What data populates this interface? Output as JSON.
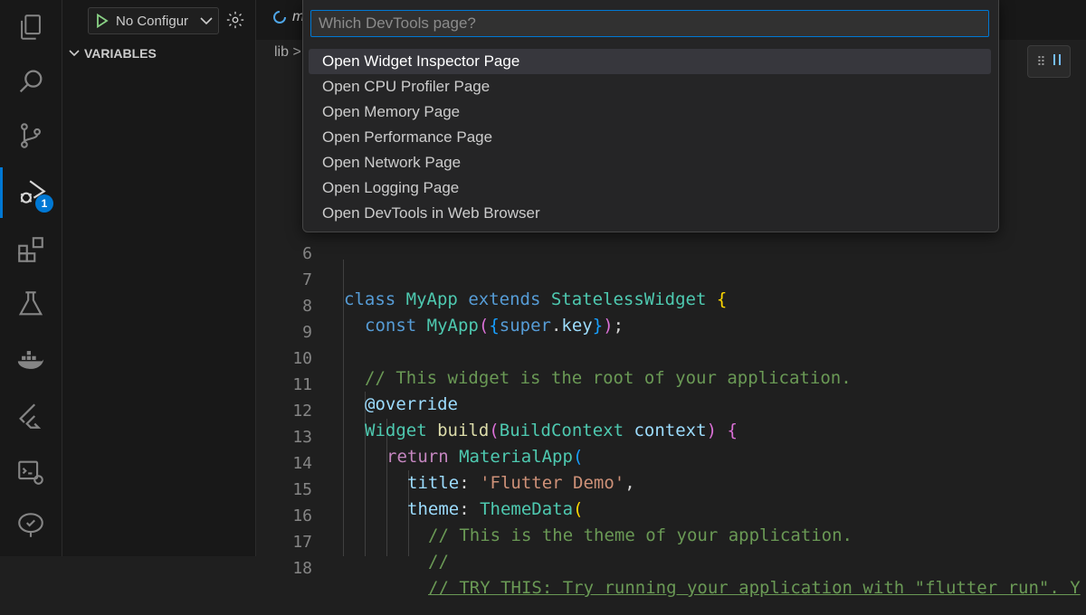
{
  "activity_bar": {
    "items": [
      {
        "icon": "explorer-icon"
      },
      {
        "icon": "search-icon"
      },
      {
        "icon": "source-control-icon"
      },
      {
        "icon": "run-debug-icon",
        "badge": "1"
      },
      {
        "icon": "extensions-icon"
      },
      {
        "icon": "testing-icon"
      },
      {
        "icon": "docker-icon"
      },
      {
        "icon": "flutter-icon"
      },
      {
        "icon": "remote-explorer-icon"
      },
      {
        "icon": "accounts-icon"
      }
    ]
  },
  "sidebar": {
    "debug_config": "No Configur",
    "variables_header": "VARIABLES"
  },
  "editor": {
    "tab_fragment": "m",
    "breadcrumb": "lib >"
  },
  "quick_pick": {
    "placeholder": "Which DevTools page?",
    "items": [
      "Open Widget Inspector Page",
      "Open CPU Profiler Page",
      "Open Memory Page",
      "Open Performance Page",
      "Open Network Page",
      "Open Logging Page",
      "Open DevTools in Web Browser"
    ],
    "selected_index": 0
  },
  "code": {
    "line_numbers": [
      "6",
      "7",
      "8",
      "9",
      "10",
      "11",
      "12",
      "13",
      "14",
      "15",
      "16",
      "17",
      "18"
    ],
    "l7": {
      "kw1": "class",
      "name": "MyApp",
      "kw2": "extends",
      "type": "StatelessWidget",
      "brace": "{"
    },
    "l8": {
      "kw": "const",
      "name": "MyApp",
      "p1": "(",
      "b1": "{",
      "sup": "super",
      "dot": ".",
      "key": "key",
      "b2": "}",
      "p2": ")",
      "semi": ";"
    },
    "l10": {
      "comment": "// This widget is the root of your application."
    },
    "l11": {
      "ann": "@override"
    },
    "l12": {
      "type": "Widget",
      "fn": "build",
      "p1": "(",
      "ptype": "BuildContext",
      "pname": "context",
      "p2": ")",
      "brace": "{"
    },
    "l13": {
      "ret": "return",
      "type": "MaterialApp",
      "p": "("
    },
    "l14": {
      "prop": "title",
      "colon": ": ",
      "str": "'Flutter Demo'",
      "comma": ","
    },
    "l15": {
      "prop": "theme",
      "colon": ": ",
      "type": "ThemeData",
      "p": "("
    },
    "l16": {
      "comment": "// This is the theme of your application."
    },
    "l17": {
      "comment": "//"
    },
    "l18": {
      "comment": "// TRY THIS: Try running your application with \"flutter run\". Y"
    }
  }
}
